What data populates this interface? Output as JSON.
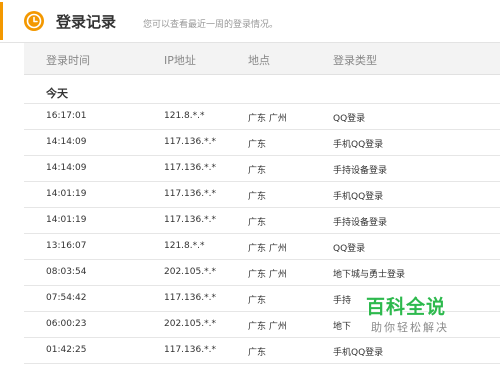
{
  "header": {
    "title": "登录记录",
    "description": "您可以查看最近一周的登录情况。",
    "icon": "clock-icon",
    "accent_color": "#f39800"
  },
  "table": {
    "columns": [
      "登录时间",
      "IP地址",
      "地点",
      "登录类型"
    ],
    "group_label": "今天",
    "rows": [
      {
        "time": "16:17:01",
        "ip": "121.8.*.*",
        "location": "广东 广州",
        "type": "QQ登录"
      },
      {
        "time": "14:14:09",
        "ip": "117.136.*.*",
        "location": "广东",
        "type": "手机QQ登录"
      },
      {
        "time": "14:14:09",
        "ip": "117.136.*.*",
        "location": "广东",
        "type": "手持设备登录"
      },
      {
        "time": "14:01:19",
        "ip": "117.136.*.*",
        "location": "广东",
        "type": "手机QQ登录"
      },
      {
        "time": "14:01:19",
        "ip": "117.136.*.*",
        "location": "广东",
        "type": "手持设备登录"
      },
      {
        "time": "13:16:07",
        "ip": "121.8.*.*",
        "location": "广东 广州",
        "type": "QQ登录"
      },
      {
        "time": "08:03:54",
        "ip": "202.105.*.*",
        "location": "广东 广州",
        "type": "地下城与勇士登录"
      },
      {
        "time": "07:54:42",
        "ip": "117.136.*.*",
        "location": "广东",
        "type": "手持"
      },
      {
        "time": "06:00:23",
        "ip": "202.105.*.*",
        "location": "广东 广州",
        "type": "地下"
      },
      {
        "time": "01:42:25",
        "ip": "117.136.*.*",
        "location": "广东",
        "type": "手机QQ登录"
      }
    ]
  },
  "watermark": {
    "brand": "百科全说",
    "slogan": "助你轻松解决",
    "color": "#2db94d"
  }
}
